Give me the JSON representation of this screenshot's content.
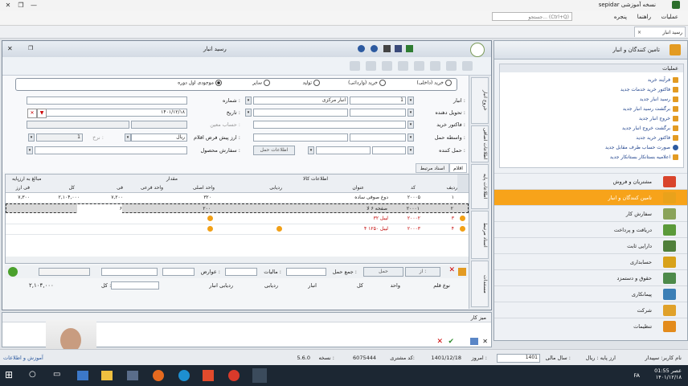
{
  "app": {
    "title": "sepidar نسخه آموزشی",
    "menu": [
      "عملیات",
      "راهنما",
      "پنجره"
    ],
    "search_placeholder": "جستجو... (Ctrl+Q)"
  },
  "doc_tab": "رسید انبار",
  "window": {
    "title": "رسید انبار",
    "radios": [
      "خرید (داخلی)",
      "خرید (وارداتی)",
      "تولید",
      "سایر",
      "موجودی اول دوره"
    ],
    "selected_radio": "موجودی اول دوره",
    "labels": {
      "warehouse": "انبار :",
      "deliverer": "تحویل دهنده :",
      "purchase_invoice": "فاکتور خرید :",
      "transit": "واسطه حمل :",
      "number": "شماره :",
      "date": "تاریخ :",
      "account": "حساب معین :",
      "prev_allocation": "ارز پیش فرض اقلام :",
      "rate": "نرخ :",
      "product_order": "سفارش محصول :",
      "carrier": "حمل کننده :",
      "shipping_info": "اطلاعات حمل"
    },
    "values": {
      "warehouse_code": "1",
      "warehouse_name": "انبار مرکزی",
      "date": "۱۴۰۱/۱۲/۱۸",
      "currency": "ریال",
      "rate_value": "1"
    },
    "side_tabs": [
      "خروج انبار",
      "اطلاعات اضافی",
      "اطلاعات پایه",
      "اسناد مرتبط",
      "مستندات"
    ],
    "grid_tabs": [
      "اقلام",
      "اسناد مرتبط"
    ],
    "grid": {
      "group_headers": [
        "اطلاعات کالا",
        "مقدار",
        "مبالغ به ارزپایه"
      ],
      "columns": [
        "ردیف",
        "کد",
        "عنوان",
        "ردیابی",
        "واحد اصلی",
        "واحد فرعی",
        "فی",
        "کل",
        "فی ارز"
      ],
      "rows": [
        {
          "idx": "۱",
          "code": "۲۰۰۰۵",
          "title": "دوغ صوفی ساده",
          "qty": "۳۲۰",
          "unit_price": "۷,۲۰۰",
          "total": "۲,۱۰۴,۰۰۰",
          "cur": "۷,۳۰۰"
        },
        {
          "idx": "۲",
          "code": "۲۰۰۰۱",
          "title": "صفحه ۶ لا",
          "qty": "۲۰۰",
          "unit_price": "۶",
          "total": "",
          "cur": ""
        },
        {
          "idx": "۳",
          "code": "۲۰۰۰۲",
          "title": "لیبل ۳۲",
          "qty": "",
          "unit_price": "",
          "total": "",
          "cur": ""
        },
        {
          "idx": "۴",
          "code": "۲۰۰۰۳",
          "title": "لیبل ۱۲۵۰ ۴",
          "qty": "",
          "unit_price": "",
          "total": "",
          "cur": ""
        }
      ]
    },
    "bottom": {
      "from": "از :",
      "transport": "حمل",
      "total_shipping": "جمع حمل :",
      "tax": "مالیات :",
      "duty": "عوارض :",
      "total": "کل :",
      "total_value": "۲,۱۰۴,۰۰۰"
    },
    "footer_cols": [
      "نوع قلم",
      "واحد",
      "کل",
      "انبار",
      "ردیابی",
      "ردیابی انبار"
    ]
  },
  "right_panel": {
    "title": "تامین کنندگان و انبار",
    "ops_title": "عملیات",
    "ops": [
      "فرآیند خرید",
      "فاکتور خرید خدمات جدید",
      "رسید انبار جدید",
      "برگشت رسید انبار جدید",
      "خروج انبار جدید",
      "برگشت خروج انبار جدید",
      "فاکتور خرید جدید",
      "صورت حساب طرف مقابل جدید",
      "اعلامیه بستانکار بستانکار جدید"
    ],
    "modules": [
      {
        "label": "مشتریان و فروش",
        "color": "#d9442c"
      },
      {
        "label": "تامین کنندگان و انبار",
        "color": "#e9a21b",
        "active": true
      },
      {
        "label": "سفارش کار",
        "color": "#8aa35a"
      },
      {
        "label": "دریافت و پرداخت",
        "color": "#5b9a3a"
      },
      {
        "label": "دارایی ثابت",
        "color": "#4f7f3a"
      },
      {
        "label": "حسابداری",
        "color": "#d8a21a"
      },
      {
        "label": "حقوق و دستمزد",
        "color": "#4d8a4a"
      },
      {
        "label": "پیمانکاری",
        "color": "#3c7fb6"
      },
      {
        "label": "شرکت",
        "color": "#e0a12a"
      },
      {
        "label": "تنظیمات",
        "color": "#e38b1c"
      }
    ]
  },
  "message_panel": {
    "title": "میز کار"
  },
  "status": {
    "user": "نام کاربر: سپیدار",
    "base_currency": "ارز پایه : ریال",
    "fiscal_year": "سال مالی :",
    "fiscal_year_value": "1401",
    "today": "امروز :",
    "today_value": "1401/12/18",
    "customer_code": "کد مشتری:",
    "customer_code_value": "6075444",
    "version": "نسخه :",
    "version_value": "5.6.0",
    "company": "آموزش و اطلاعات"
  },
  "taskbar": {
    "time": "01:55 عصر",
    "date": "۱۴۰۱/۱۲/۱۸",
    "lang": "FA"
  }
}
